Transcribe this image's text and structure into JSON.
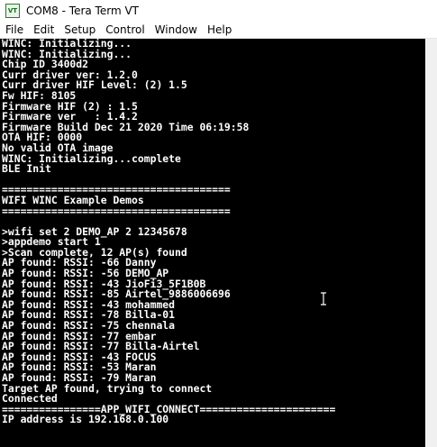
{
  "window": {
    "icon_label": "VT",
    "title": "COM8 - Tera Term VT"
  },
  "menu": [
    "File",
    "Edit",
    "Setup",
    "Control",
    "Window",
    "Help"
  ],
  "terminal": {
    "lines": [
      "WINC: Initializing...",
      "WINC: Initializing...",
      "Chip ID 3400d2",
      "Curr driver ver: 1.2.0",
      "Curr driver HIF Level: (2) 1.5",
      "Fw HIF: 8105",
      "Firmware HIF (2) : 1.5",
      "Firmware ver   : 1.4.2",
      "Firmware Build Dec 21 2020 Time 06:19:58",
      "OTA HIF: 0000",
      "No valid OTA image",
      "WINC: Initializing...complete",
      "BLE Init",
      "",
      "=====================================",
      "WIFI WINC Example Demos",
      "=====================================",
      "",
      ">wifi set 2 DEMO_AP 2 12345678",
      ">appdemo start 1",
      ">Scan complete, 12 AP(s) found",
      "AP found: RSSI: -66 Danny",
      "AP found: RSSI: -56 DEMO_AP",
      "AP found: RSSI: -43 JioFi3_5F1B0B",
      "AP found: RSSI: -85 Airtel_9886006696",
      "AP found: RSSI: -43 mohammed",
      "AP found: RSSI: -78 Billa-01",
      "AP found: RSSI: -75 chennala",
      "AP found: RSSI: -77 embar",
      "AP found: RSSI: -77 Billa-Airtel",
      "AP found: RSSI: -43 FOCUS",
      "AP found: RSSI: -53 Maran",
      "AP found: RSSI: -79 Maran",
      "Target AP found, trying to connect",
      "Connected",
      "================APP_WIFI_CONNECT======================",
      "IP address is 192.168.0.100"
    ]
  }
}
